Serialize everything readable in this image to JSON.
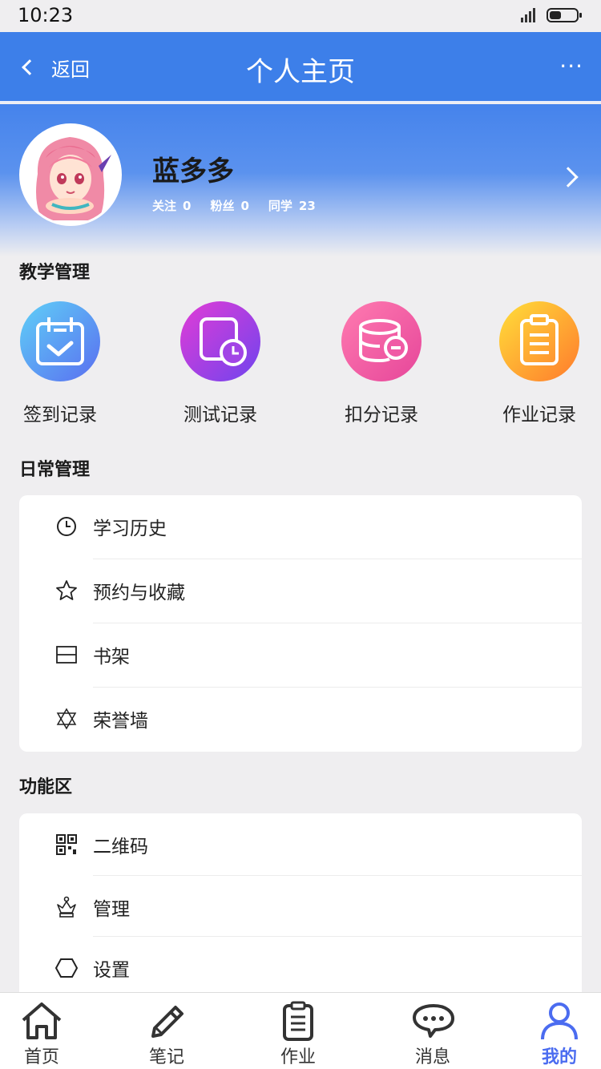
{
  "status_bar": {
    "time": "10:23"
  },
  "nav": {
    "back_label": "返回",
    "title": "个人主页",
    "more_label": "···"
  },
  "profile": {
    "name": "蓝多多",
    "stats": [
      {
        "label": "关注",
        "value": "0"
      },
      {
        "label": "粉丝",
        "value": "0"
      },
      {
        "label": "同学",
        "value": "23"
      }
    ]
  },
  "teaching": {
    "title": "教学管理",
    "items": [
      {
        "label": "签到记录",
        "icon": "calendar-check-icon",
        "color_from": "#5fb6f5",
        "color_to": "#5a6ef0"
      },
      {
        "label": "测试记录",
        "icon": "timer-file-icon",
        "color_from": "#c23de0",
        "color_to": "#6b4ef0"
      },
      {
        "label": "扣分记录",
        "icon": "database-minus-icon",
        "color_from": "#ff6aa0",
        "color_to": "#e64e9a"
      },
      {
        "label": "作业记录",
        "icon": "clipboard-icon",
        "color_from": "#ffd43c",
        "color_to": "#ff7f2a"
      }
    ]
  },
  "daily": {
    "title": "日常管理",
    "items": [
      {
        "label": "学习历史",
        "icon": "clock-icon"
      },
      {
        "label": "预约与收藏",
        "icon": "star-icon"
      },
      {
        "label": "书架",
        "icon": "bookshelf-icon"
      },
      {
        "label": "荣誉墙",
        "icon": "hexagram-icon"
      }
    ]
  },
  "functions": {
    "title": "功能区",
    "items": [
      {
        "label": "二维码",
        "icon": "qr-code-icon"
      },
      {
        "label": "管理",
        "icon": "crown-icon"
      },
      {
        "label": "设置",
        "icon": "hexagon-icon"
      }
    ]
  },
  "tabbar": {
    "active": "我的",
    "items": [
      {
        "label": "首页",
        "icon": "home-icon"
      },
      {
        "label": "笔记",
        "icon": "pencil-icon"
      },
      {
        "label": "作业",
        "icon": "clipboard-icon"
      },
      {
        "label": "消息",
        "icon": "chat-icon"
      },
      {
        "label": "我的",
        "icon": "user-icon"
      }
    ]
  },
  "colors": {
    "primary": "#3d7fe9",
    "active_tab": "#4b6cf0",
    "background": "#efeef0"
  }
}
